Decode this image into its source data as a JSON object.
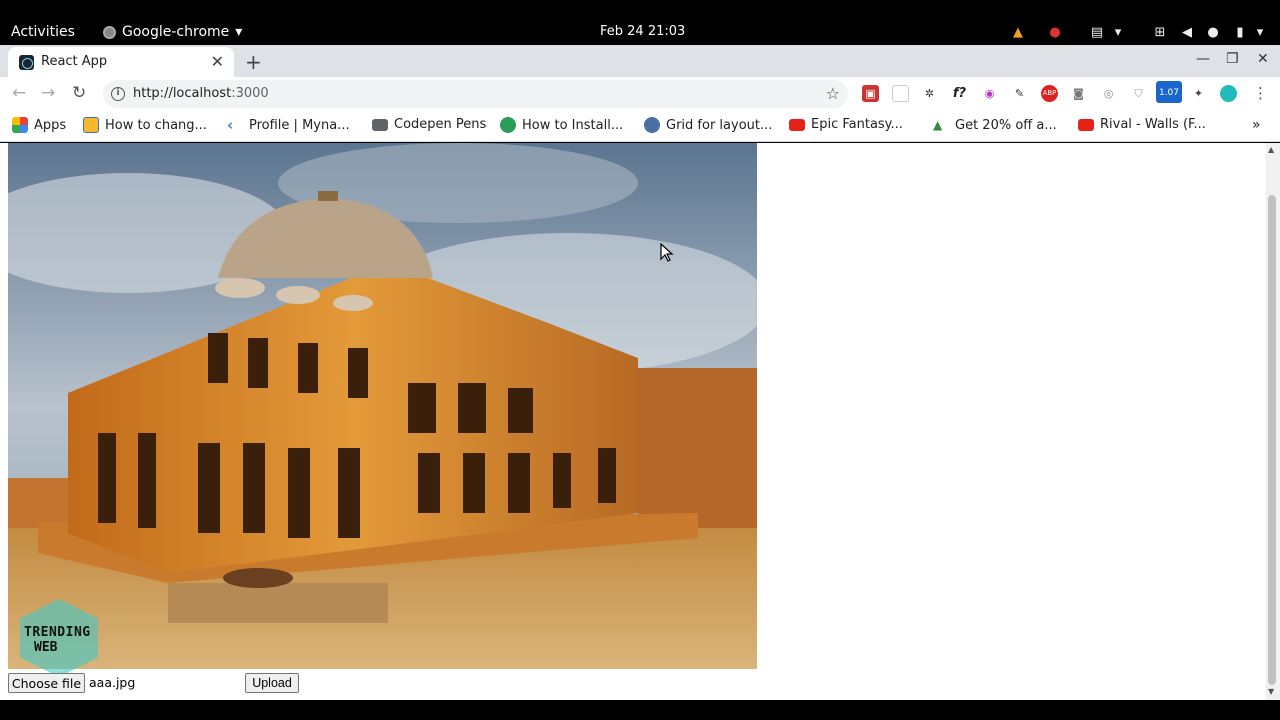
{
  "system_bar": {
    "activities": "Activities",
    "app_name": "Google-chrome",
    "clock": "Feb 24  21:03"
  },
  "browser": {
    "tab_title": "React App",
    "url_host": "http://localhost",
    "url_port": ":3000",
    "extension_badge": "1.07",
    "bookmarks": [
      {
        "label": "Apps",
        "icon": "apps-grid-icon"
      },
      {
        "label": "How to chang...",
        "icon": "linux-icon"
      },
      {
        "label": "Profile | Myna...",
        "icon": "myna-icon"
      },
      {
        "label": "Codepen Pens",
        "icon": "folder-icon"
      },
      {
        "label": "How to Install...",
        "icon": "tool-icon"
      },
      {
        "label": "Grid for layout...",
        "icon": "globe-icon"
      },
      {
        "label": "Epic Fantasy...",
        "icon": "youtube-icon"
      },
      {
        "label": "Get 20% off a...",
        "icon": "envato-icon"
      },
      {
        "label": "Rival - Walls (F...",
        "icon": "youtube-icon"
      }
    ]
  },
  "page": {
    "choose_file_label": "Choose file",
    "file_name": "aaa.jpg",
    "upload_label": "Upload",
    "watermark_line1": "TRENDING",
    "watermark_line2": "WEB"
  },
  "colors": {
    "tab_strip": "#dee1e6",
    "youtube": "#e62117",
    "react": "#61dafb"
  }
}
